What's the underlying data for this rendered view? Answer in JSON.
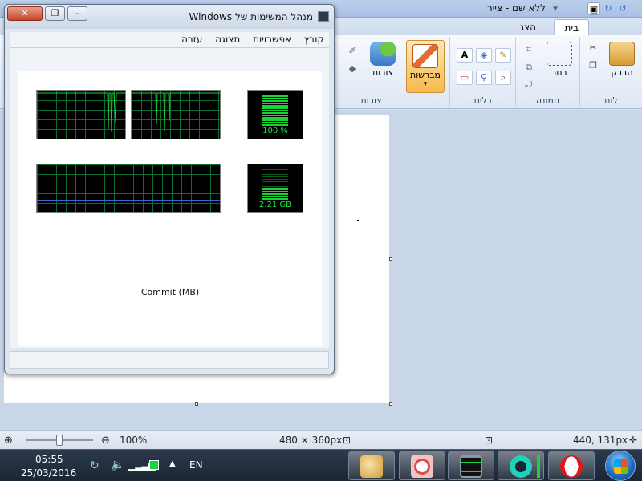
{
  "paint": {
    "title": "ללא שם - צייר",
    "tabs": {
      "home": "בית",
      "view": "הצג"
    },
    "groups": {
      "clipboard": {
        "label": "לוח",
        "paste": "הדבק"
      },
      "image": {
        "label": "תמונה",
        "select": "בחר"
      },
      "tools": {
        "label": "כלים"
      },
      "brushes": {
        "label": "מברשות"
      },
      "shapes": {
        "label": "צורות",
        "shapes_btn": "צורות"
      }
    },
    "status": {
      "cursor_pos": "440, 131px",
      "image_size": "480 × 360px",
      "zoom": "100%"
    }
  },
  "taskmgr": {
    "title": "מנהל המשימות של Windows",
    "menu": [
      "קובץ",
      "אפשרויות",
      "תצוגה",
      "עזרה"
    ],
    "cpu_meter_label": "100 %",
    "memory_meter_label": "2.21 GB",
    "commit_label": "Commit (MB)"
  },
  "taskbar": {
    "time": "05:55",
    "date": "25/03/2016",
    "language": "EN"
  },
  "colors": {
    "graph_green": "#19d433",
    "paint_accent": "#f6b94a",
    "taskbar_bg": "#1b2634"
  }
}
